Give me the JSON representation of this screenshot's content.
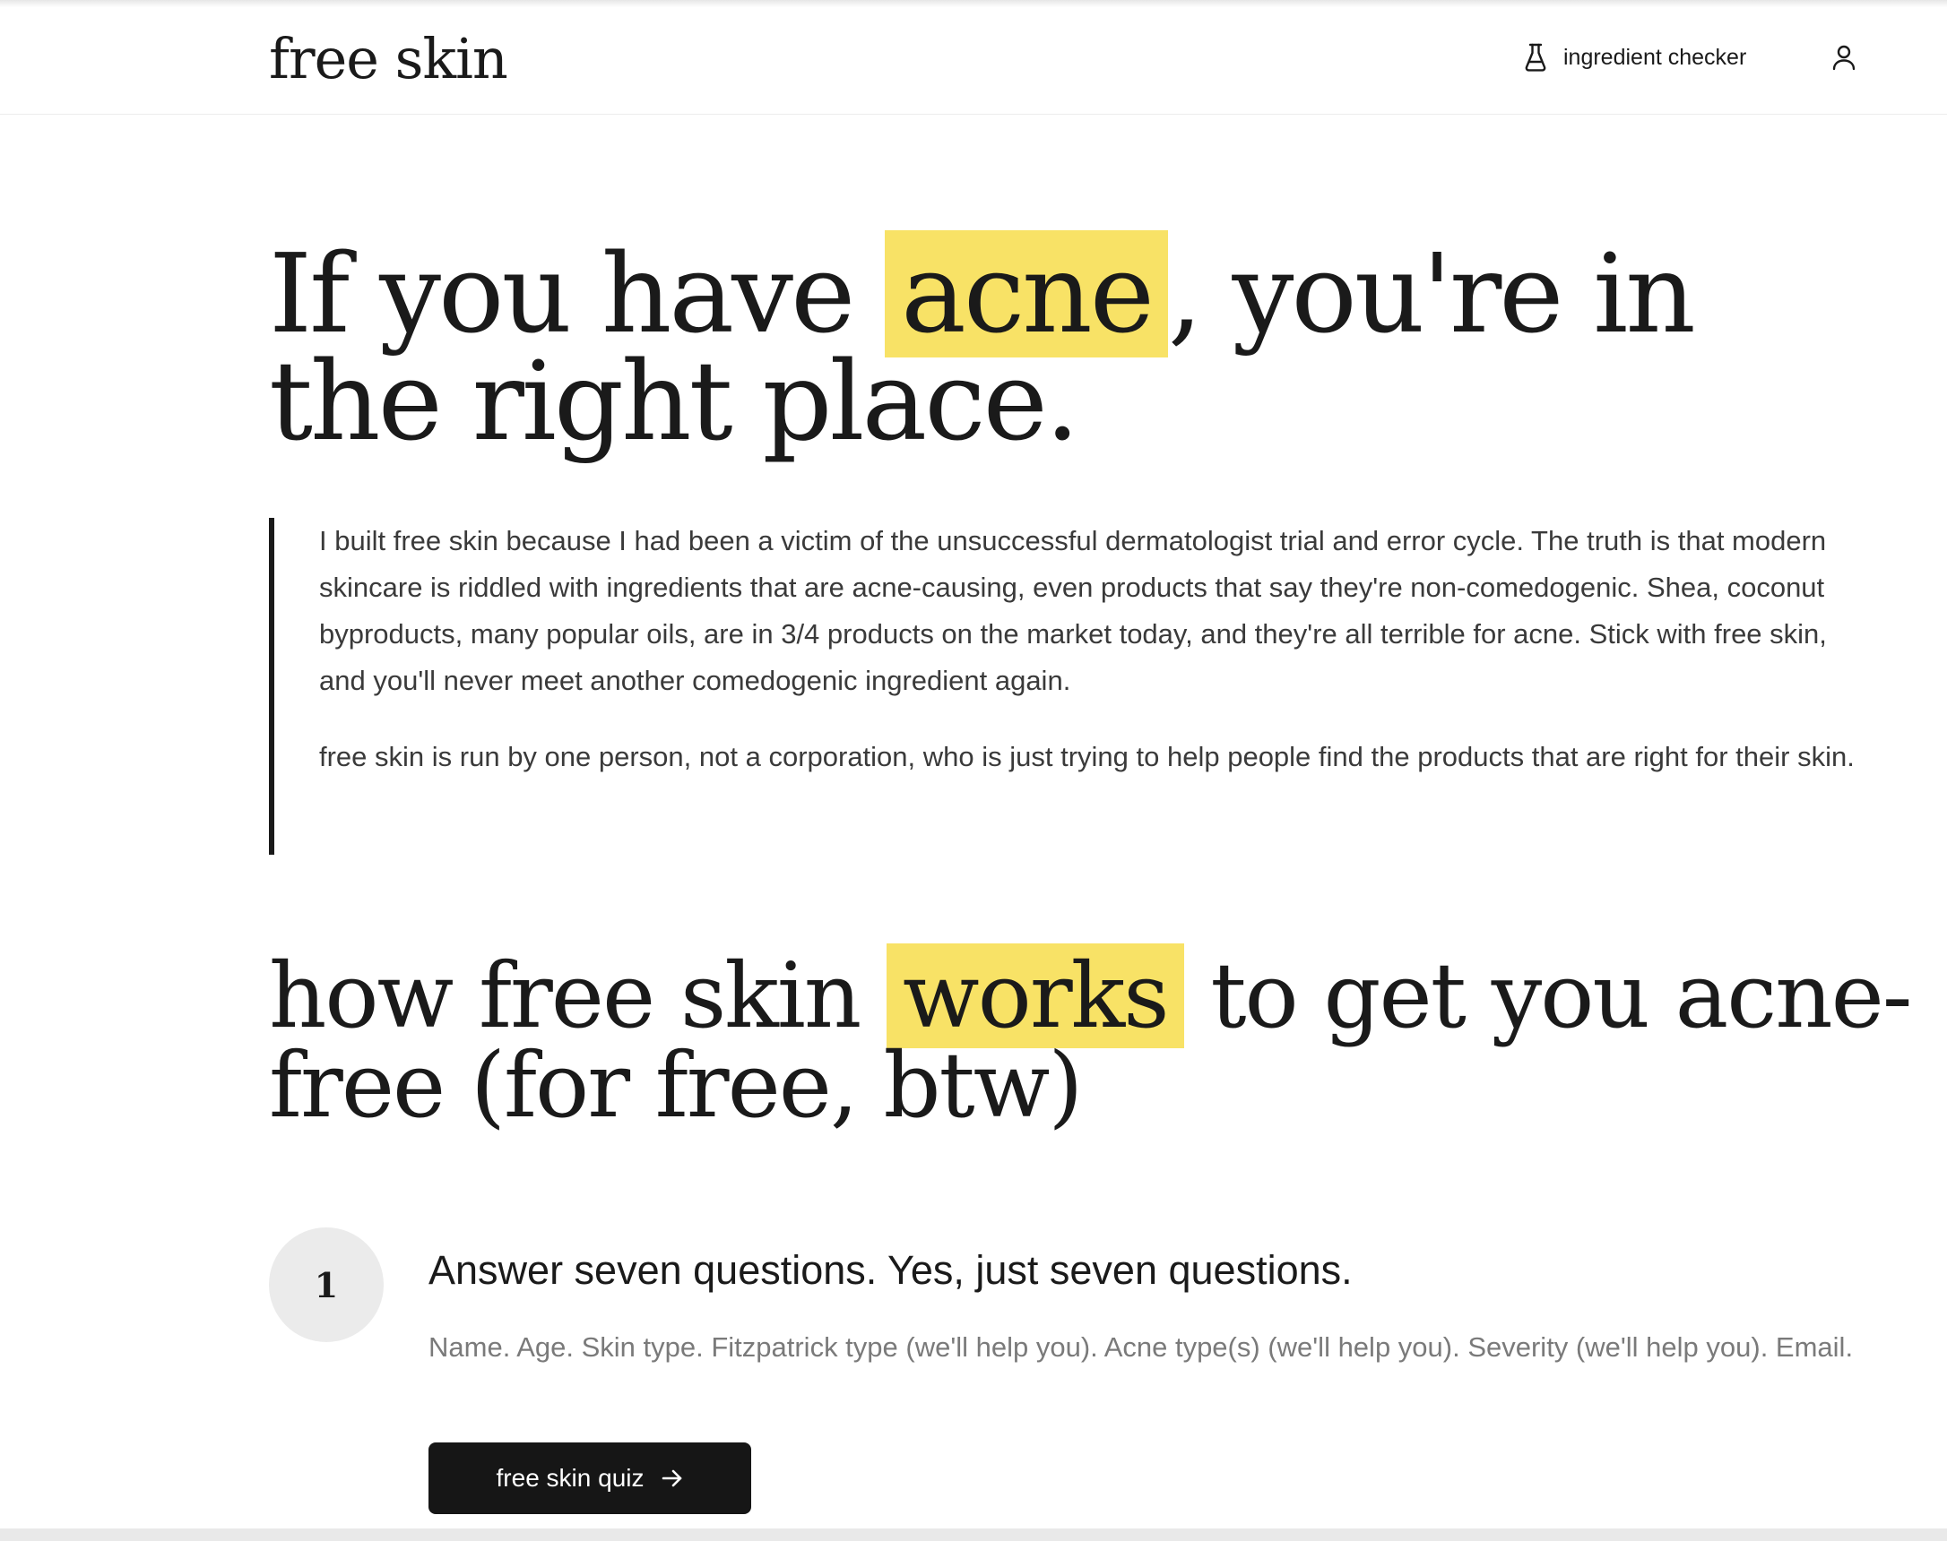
{
  "header": {
    "logo": "free skin",
    "nav_link_label": "ingredient checker",
    "nav_link_icon": "flask-icon",
    "account_icon": "user-icon"
  },
  "hero": {
    "title_before": "If you have ",
    "title_highlight": "acne",
    "title_after": ", you're in the right place.",
    "highlight_color": "#f8e266"
  },
  "intro": {
    "paragraph_1": "I built free skin because I had been a victim of the unsuccessful dermatologist trial and error cycle. The truth is that modern skincare is riddled with ingredients that are acne-causing, even products that say they're non-comedogenic. Shea, coconut byproducts, many popular oils, are in 3/4 products on the market today, and they're all terrible for acne. Stick with free skin, and you'll never meet another comedogenic ingredient again.",
    "paragraph_2": "free skin is run by one person, not a corporation, who is just trying to help people find the products that are right for their skin."
  },
  "how_it_works": {
    "title_before": "how free skin ",
    "title_highlight": "works",
    "title_after": " to get you acne-free (for free, btw)"
  },
  "steps": [
    {
      "number": "1",
      "title": "Answer seven questions. Yes, just seven questions.",
      "description": "Name. Age. Skin type. Fitzpatrick type (we'll help you). Acne type(s) (we'll help you). Severity (we'll help you). Email.",
      "button_label": "free skin quiz",
      "button_icon": "arrow-right-icon"
    }
  ],
  "colors": {
    "text": "#1a1a1a",
    "button_bg": "#161616",
    "step_circle_bg": "#ebebeb"
  }
}
